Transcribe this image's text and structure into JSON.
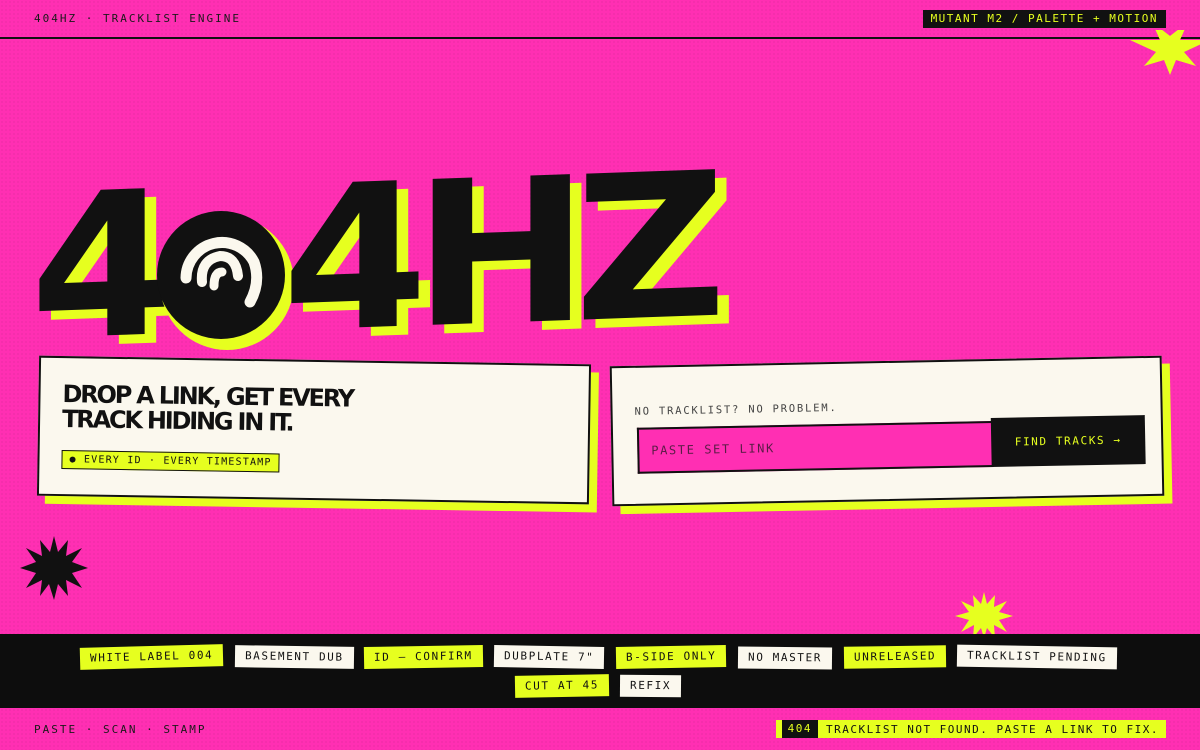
{
  "header": {
    "brand_tag": "404HZ · TRACKLIST ENGINE",
    "version_badge": "MUTANT M2 / PALETTE + MOTION"
  },
  "logo": {
    "left": "4",
    "right": "4HZ",
    "disc_icon": "broadcast-wave-disc-icon"
  },
  "hero": {
    "headline_line1": "DROP A LINK, GET EVERY",
    "headline_line2": "TRACK HIDING IN IT.",
    "chip": "● EVERY ID · EVERY TIMESTAMP"
  },
  "search": {
    "label": "NO TRACKLIST? NO PROBLEM.",
    "placeholder": "PASTE SET LINK",
    "value": "",
    "button_label": "FIND TRACKS →"
  },
  "tags": [
    {
      "label": "WHITE LABEL 004",
      "style": "yellow"
    },
    {
      "label": "BASEMENT DUB",
      "style": "white"
    },
    {
      "label": "ID — CONFIRM",
      "style": "yellow"
    },
    {
      "label": "DUBPLATE 7\"",
      "style": "white"
    },
    {
      "label": "B-SIDE ONLY",
      "style": "yellow"
    },
    {
      "label": "NO MASTER",
      "style": "white"
    },
    {
      "label": "UNRELEASED",
      "style": "yellow"
    },
    {
      "label": "TRACKLIST PENDING",
      "style": "white"
    },
    {
      "label": "CUT AT 45",
      "style": "yellow"
    },
    {
      "label": "REFIX",
      "style": "white"
    }
  ],
  "footer": {
    "left": "PASTE · SCAN · STAMP",
    "status_code": "404",
    "status_text": "TRACKLIST NOT FOUND. PASTE A LINK TO FIX."
  },
  "colors": {
    "background": "#ff2fb3",
    "accent": "#e6ff1f",
    "ink": "#111111",
    "paper": "#fbf8ee"
  }
}
